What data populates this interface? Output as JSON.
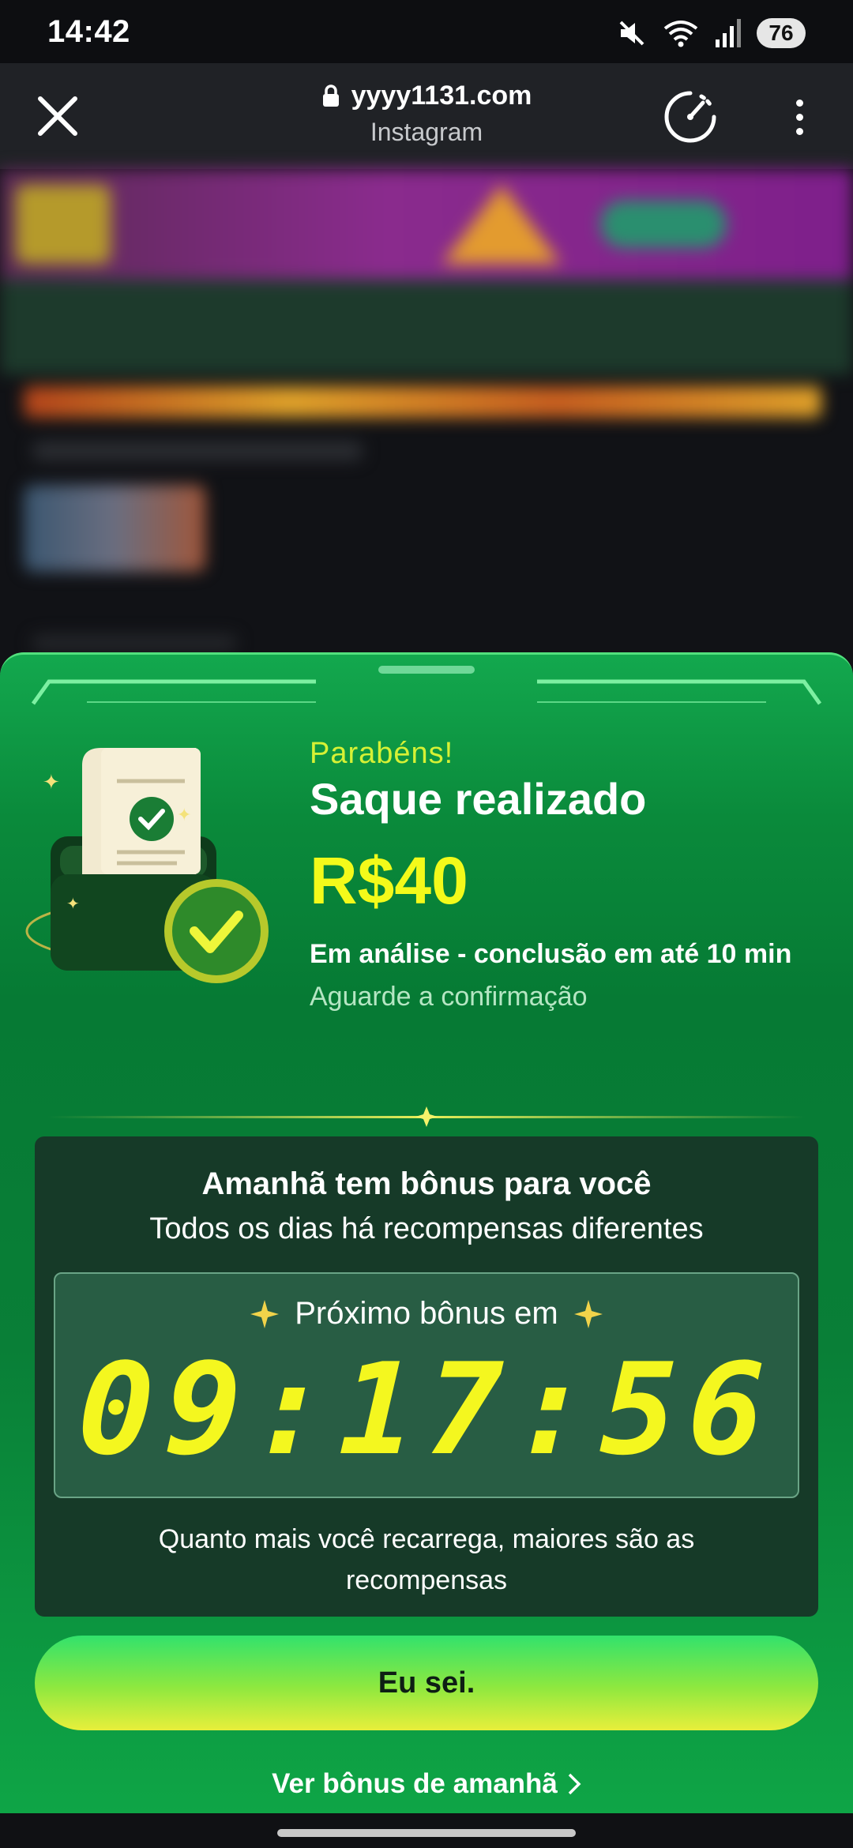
{
  "status_bar": {
    "time": "14:42",
    "battery": "76"
  },
  "browser": {
    "url": "yyyy1131.com",
    "source": "Instagram"
  },
  "sheet": {
    "congrats": "Parabéns!",
    "title": "Saque realizado",
    "amount": "R$40",
    "analysis": "Em análise - conclusão em até 10 min",
    "wait": "Aguarde a confirmação",
    "bonus": {
      "title": "Amanhã tem bônus para você",
      "subtitle": "Todos os dias há recompensas diferentes",
      "next_label": "Próximo bônus em",
      "countdown": "09:17:56",
      "note": "Quanto mais você recarrega, maiores são as recompensas"
    },
    "ok_button": "Eu sei.",
    "tomorrow_link": "Ver bônus de amanhã"
  },
  "colors": {
    "sheet_green": "#067a34",
    "accent_yellow": "#f3fa1a",
    "congrats_yellow": "#d6f135",
    "card_dark": "#163a28"
  },
  "icons": [
    "close-icon",
    "lock-icon",
    "speed-icon",
    "more-vert-icon",
    "mute-icon",
    "wifi-icon",
    "signal-icon",
    "sparkle-icon",
    "chevron-right-icon",
    "receipt-check-icon"
  ]
}
